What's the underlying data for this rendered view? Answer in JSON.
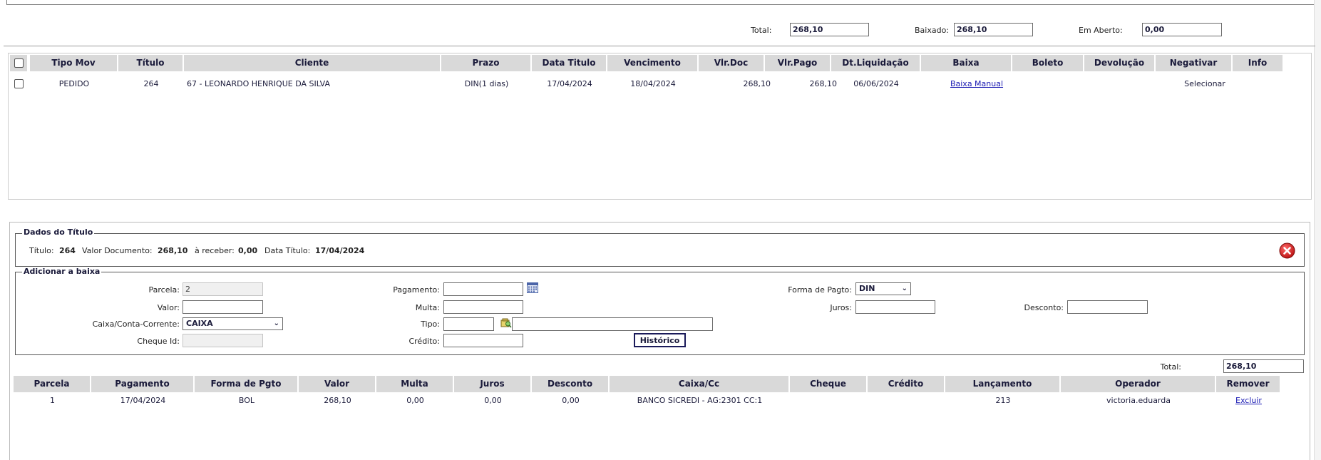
{
  "summary": {
    "total_label": "Total:",
    "total_value": "268,10",
    "baixado_label": "Baixado:",
    "baixado_value": "268,10",
    "aberto_label": "Em Aberto:",
    "aberto_value": "0,00"
  },
  "titles_table": {
    "headers": [
      "Tipo Mov",
      "Título",
      "Cliente",
      "Prazo",
      "Data Titulo",
      "Vencimento",
      "Vlr.Doc",
      "Vlr.Pago",
      "Dt.Liquidação",
      "Baixa",
      "Boleto",
      "Devolução",
      "Negativar",
      "Info"
    ],
    "rows": [
      {
        "tipo_mov": "PEDIDO",
        "titulo": "264",
        "cliente": "67 - LEONARDO HENRIQUE DA SILVA",
        "prazo": "DIN(1 dias)",
        "data_titulo": "17/04/2024",
        "vencimento": "18/04/2024",
        "vlr_doc": "268,10",
        "vlr_pago": "268,10",
        "dt_liquidacao": "06/06/2024",
        "baixa": "Baixa Manual",
        "boleto": "",
        "devolucao": "",
        "negativar": "Selecionar",
        "info": ""
      }
    ]
  },
  "dados_titulo": {
    "legend": "Dados do Título",
    "titulo_label": "Título:",
    "titulo_value": "264",
    "valor_doc_label": "Valor Documento:",
    "valor_doc_value": "268,10",
    "a_receber_label": "à receber:",
    "a_receber_value": "0,00",
    "data_titulo_label": "Data Título:",
    "data_titulo_value": "17/04/2024"
  },
  "adicionar_baixa": {
    "legend": "Adicionar a baixa",
    "parcela_label": "Parcela:",
    "parcela_value": "2",
    "valor_label": "Valor:",
    "valor_value": "",
    "caixa_label": "Caixa/Conta-Corrente:",
    "caixa_value": "CAIXA",
    "cheque_label": "Cheque Id:",
    "cheque_value": "",
    "pagamento_label": "Pagamento:",
    "pagamento_value": "",
    "multa_label": "Multa:",
    "multa_value": "",
    "tipo_label": "Tipo:",
    "tipo_value": "",
    "tipo_desc_value": "",
    "credito_label": "Crédito:",
    "credito_value": "",
    "historico_button": "Histórico",
    "forma_label": "Forma de Pagto:",
    "forma_value": "DIN",
    "juros_label": "Juros:",
    "juros_value": "",
    "desconto_label": "Desconto:",
    "desconto_value": ""
  },
  "payments_total": {
    "label": "Total:",
    "value": "268,10"
  },
  "payments_table": {
    "headers": [
      "Parcela",
      "Pagamento",
      "Forma de Pgto",
      "Valor",
      "Multa",
      "Juros",
      "Desconto",
      "Caixa/Cc",
      "Cheque",
      "Crédito",
      "Lançamento",
      "Operador",
      "Remover"
    ],
    "rows": [
      {
        "parcela": "1",
        "pagamento": "17/04/2024",
        "forma": "BOL",
        "valor": "268,10",
        "multa": "0,00",
        "juros": "0,00",
        "desconto": "0,00",
        "caixa": "BANCO SICREDI - AG:2301 CC:1",
        "cheque": "",
        "credito": "",
        "lancamento": "213",
        "operador": "victoria.eduarda",
        "remover": "Excluir"
      }
    ]
  },
  "colors": {
    "header_bg": "#d9d9d9",
    "link": "#1a1ab3",
    "close_red": "#cc1f1f"
  },
  "icons": {
    "calendar": "calendar-icon",
    "lookup": "lookup-icon",
    "close": "close-icon"
  }
}
